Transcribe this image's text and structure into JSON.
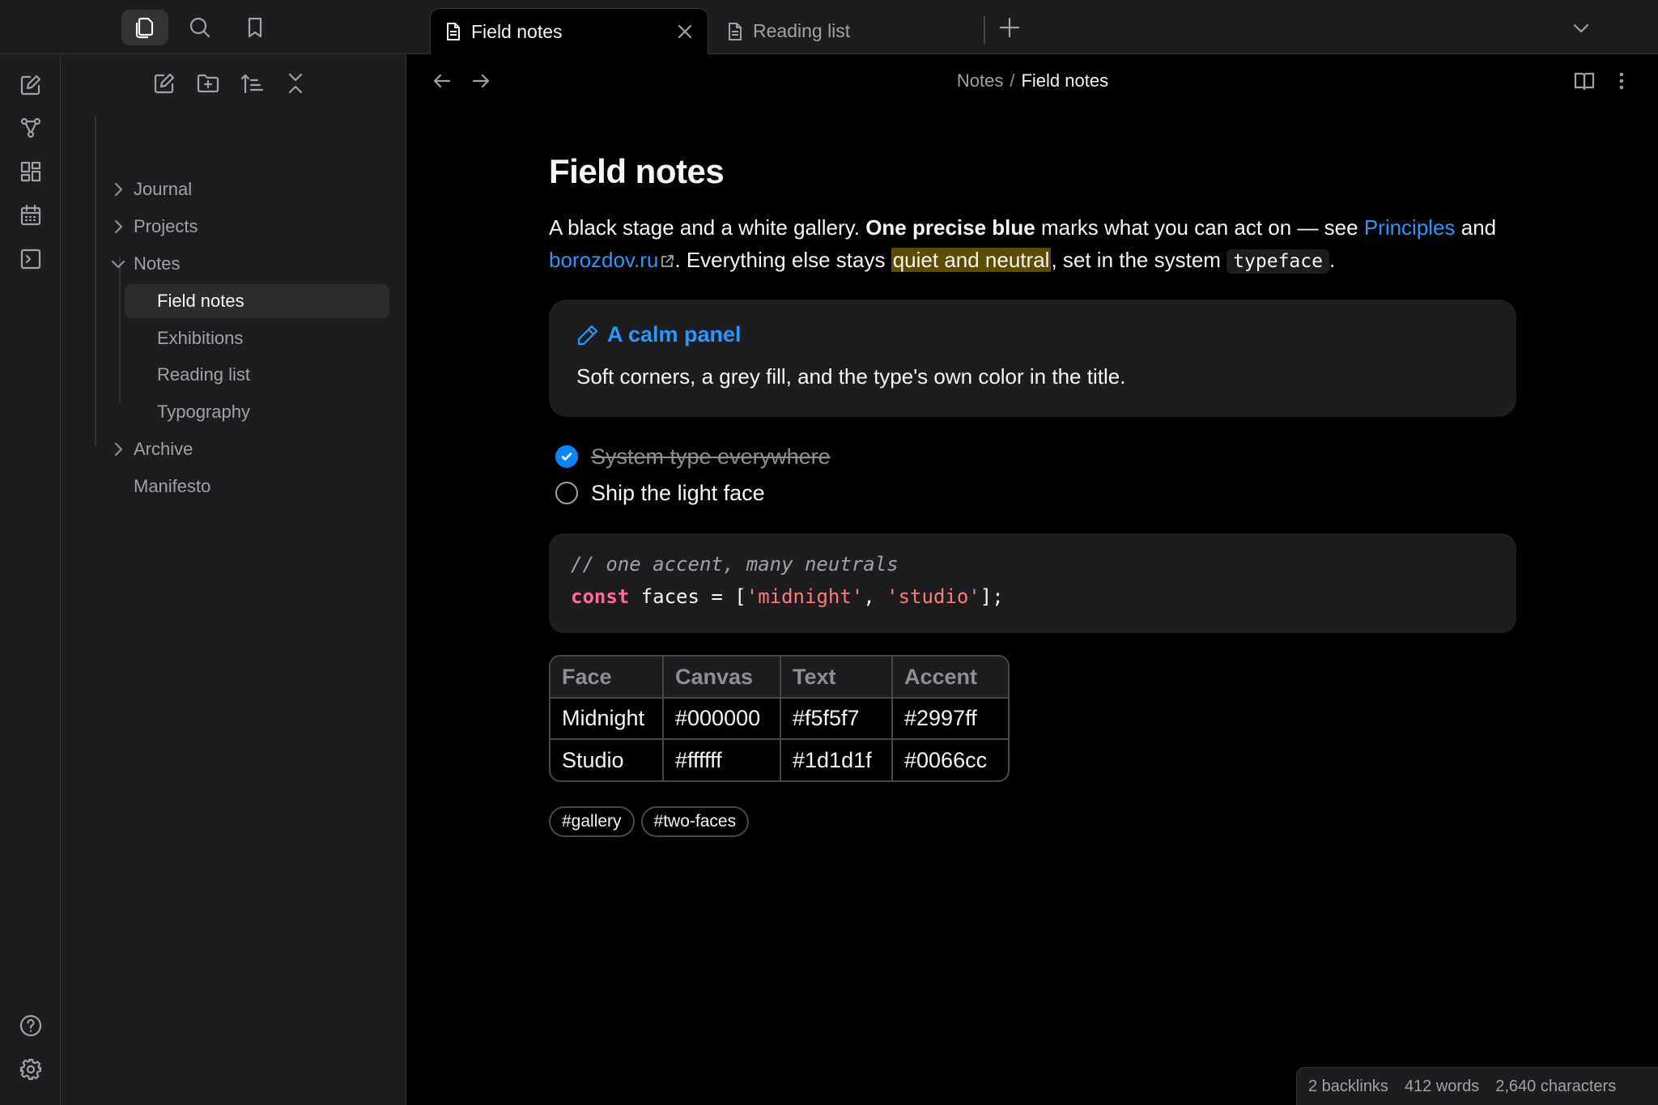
{
  "tabs": [
    {
      "label": "Field notes",
      "active": true
    },
    {
      "label": "Reading list",
      "active": false
    }
  ],
  "sidebar": {
    "tree": [
      {
        "label": "Journal",
        "type": "folder",
        "expanded": false
      },
      {
        "label": "Projects",
        "type": "folder",
        "expanded": false
      },
      {
        "label": "Notes",
        "type": "folder",
        "expanded": true
      },
      {
        "label": "Field notes",
        "type": "file",
        "selected": true
      },
      {
        "label": "Exhibitions",
        "type": "file"
      },
      {
        "label": "Reading list",
        "type": "file"
      },
      {
        "label": "Typography",
        "type": "file"
      },
      {
        "label": "Archive",
        "type": "folder",
        "expanded": false
      },
      {
        "label": "Manifesto",
        "type": "file"
      }
    ]
  },
  "header": {
    "breadcrumb_parent": "Notes",
    "breadcrumb_separator": "/",
    "breadcrumb_current": "Field notes"
  },
  "note": {
    "title": "Field notes",
    "para": {
      "t1": "A black stage and a white gallery. ",
      "bold": "One precise blue",
      "t2": " marks what you can act on — see ",
      "link1": "Principles",
      "t3": " and ",
      "link2": "borozdov.ru",
      "t4": ". Everything else stays ",
      "highlight": "quiet and neutral",
      "t5": ", set in the system ",
      "code": "typeface",
      "t6": "."
    },
    "callout": {
      "title": "A calm panel",
      "body": "Soft corners, a grey fill, and the type's own color in the title."
    },
    "tasks": [
      {
        "text": "System type everywhere",
        "done": true
      },
      {
        "text": "Ship the light face",
        "done": false
      }
    ],
    "code": {
      "comment": "// one accent, many neutrals",
      "keyword": "const",
      "ident": " faces = [",
      "str1": "'midnight'",
      "sep": ", ",
      "str2": "'studio'",
      "end": "];"
    },
    "table": {
      "headers": [
        "Face",
        "Canvas",
        "Text",
        "Accent"
      ],
      "rows": [
        [
          "Midnight",
          "#000000",
          "#f5f5f7",
          "#2997ff"
        ],
        [
          "Studio",
          "#ffffff",
          "#1d1d1f",
          "#0066cc"
        ]
      ]
    },
    "tags": [
      "#gallery",
      "#two-faces"
    ]
  },
  "status": {
    "backlinks": "2 backlinks",
    "words": "412 words",
    "characters": "2,640 characters"
  },
  "colors": {
    "accent": "#2997ff",
    "canvas": "#000000",
    "panel": "#1d1d1f",
    "text": "#f5f5f7",
    "muted": "#a1a1a6",
    "highlight": "#5c4b00"
  },
  "icons": {
    "top": [
      "files-icon",
      "search-icon",
      "bookmark-icon"
    ],
    "ribbon": [
      "new-note-icon",
      "graph-icon",
      "canvas-icon",
      "calendar-icon",
      "terminal-icon",
      "help-icon",
      "settings-icon"
    ],
    "explorer": [
      "new-note-icon",
      "new-folder-icon",
      "sort-icon",
      "collapse-all-icon"
    ]
  }
}
